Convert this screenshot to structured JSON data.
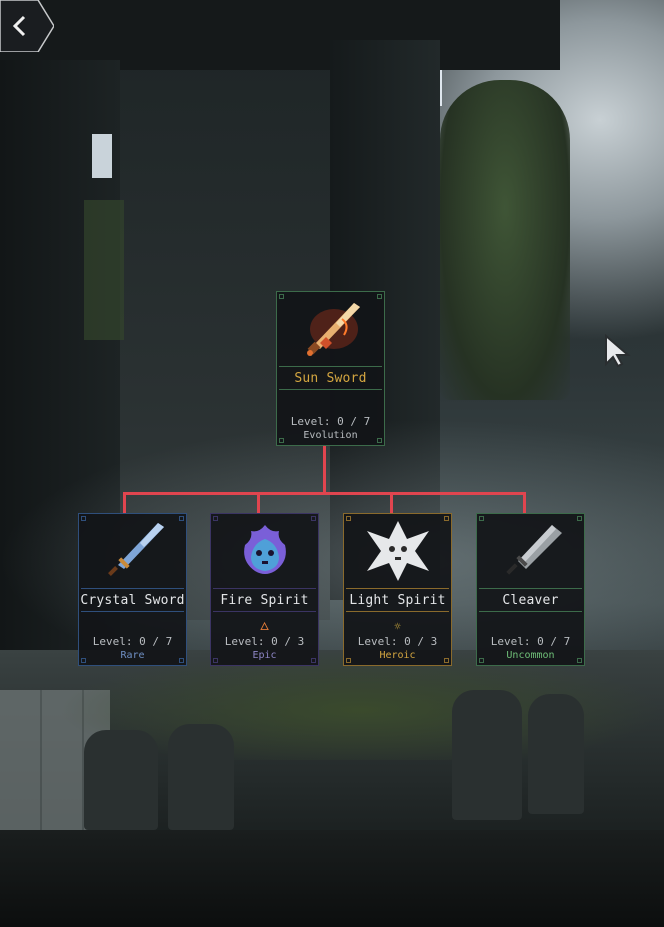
{
  "nav": {
    "back_icon": "chevron-left-icon"
  },
  "root": {
    "name": "Sun Sword",
    "level": "Level: 0 / 7",
    "rarity": "Evolution",
    "icon": "sun-sword-icon",
    "border_color": "#3c6b4a",
    "name_color": "#d4a640",
    "rarity_color": "#b9bdc1"
  },
  "connector_color": "#e0454f",
  "children": [
    {
      "name": "Crystal Sword",
      "level": "Level: 0 / 7",
      "rarity": "Rare",
      "icon": "crystal-sword-icon",
      "trait_icon": "",
      "border_color": "#2f4f7c",
      "rarity_color": "#6f8fc4"
    },
    {
      "name": "Fire Spirit",
      "level": "Level: 0 / 3",
      "rarity": "Epic",
      "icon": "fire-spirit-icon",
      "trait_icon": "🜂",
      "trait_color": "#e07a38",
      "border_color": "#3b3463",
      "rarity_color": "#8e86c6"
    },
    {
      "name": "Light Spirit",
      "level": "Level: 0 / 3",
      "rarity": "Heroic",
      "icon": "light-spirit-icon",
      "trait_icon": "☼",
      "trait_color": "#e0b840",
      "border_color": "#8a6a2c",
      "rarity_color": "#d4a640"
    },
    {
      "name": "Cleaver",
      "level": "Level: 0 / 7",
      "rarity": "Uncommon",
      "icon": "cleaver-icon",
      "trait_icon": "",
      "border_color": "#3c6b4a",
      "rarity_color": "#6fbf78"
    }
  ]
}
